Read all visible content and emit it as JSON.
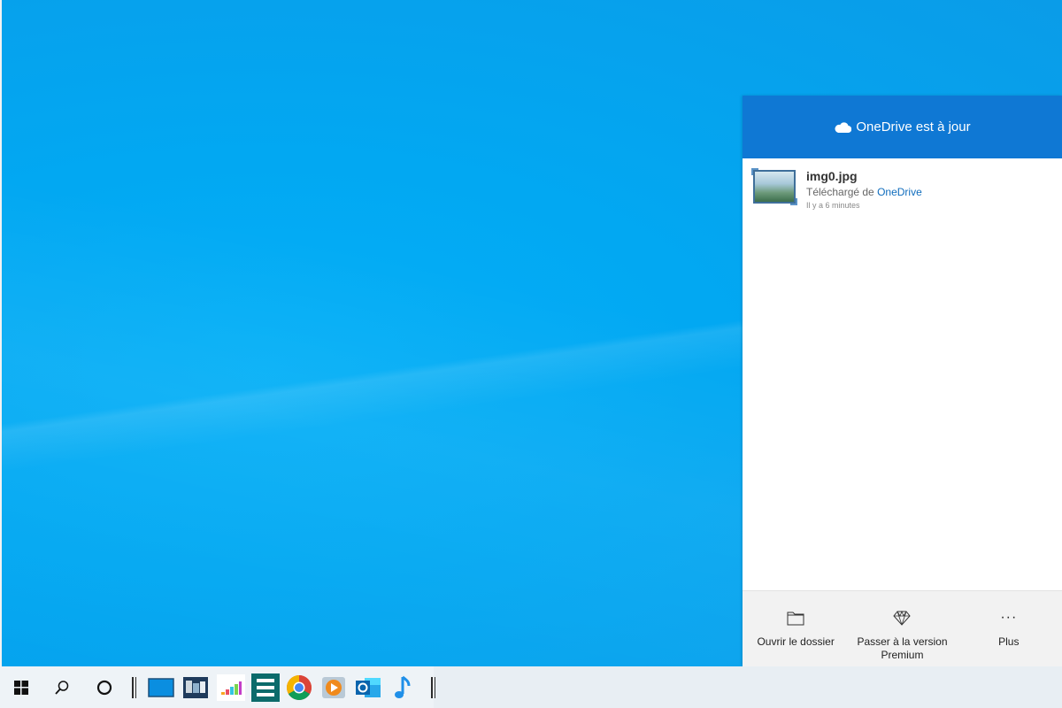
{
  "flyout": {
    "header_title": "OneDrive est à jour",
    "activity": {
      "file_name": "img0.jpg",
      "desc_prefix": "Téléchargé de",
      "desc_link": "OneDrive",
      "time": "Il y a 6 minutes"
    },
    "footer": {
      "open_folder": "Ouvrir le dossier",
      "premium_line1": "Passer à la version",
      "premium_line2": "Premium",
      "more": "Plus",
      "more_icon": "···"
    }
  },
  "taskbar": {
    "icons": [
      "start-icon",
      "search-icon",
      "cortana-icon",
      "desktop-app-icon",
      "file-manager-icon",
      "deezer-icon",
      "elementor-icon",
      "chrome-icon",
      "media-player-icon",
      "outlook-icon",
      "music-note-icon"
    ]
  },
  "colors": {
    "desktop": "#03a9f4",
    "onedrive_header": "#0f78d4",
    "link": "#0f6cbd"
  }
}
